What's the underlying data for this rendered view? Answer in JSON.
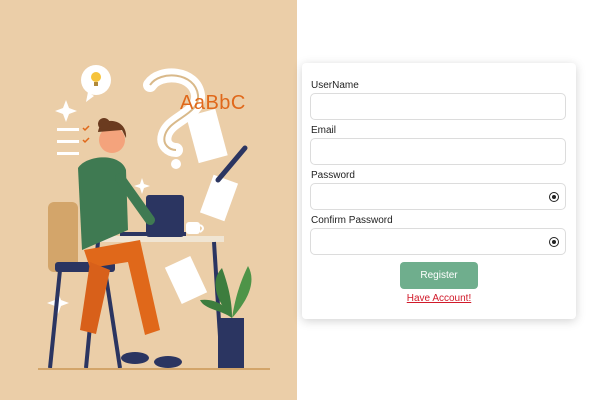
{
  "illustration": {
    "doodle_text": "AaBbC"
  },
  "form": {
    "fields": [
      {
        "label": "UserName",
        "value": "",
        "placeholder": ""
      },
      {
        "label": "Email",
        "value": "",
        "placeholder": ""
      },
      {
        "label": "Password",
        "value": "",
        "placeholder": "",
        "icon": "eye-icon"
      },
      {
        "label": "Confirm Password",
        "value": "",
        "placeholder": "",
        "icon": "eye-icon"
      }
    ],
    "register_label": "Register",
    "have_account_label": "Have Account!"
  },
  "colors": {
    "illustration_bg": "#ebcea8",
    "button": "#6fae8d",
    "link": "#d11a2a"
  }
}
